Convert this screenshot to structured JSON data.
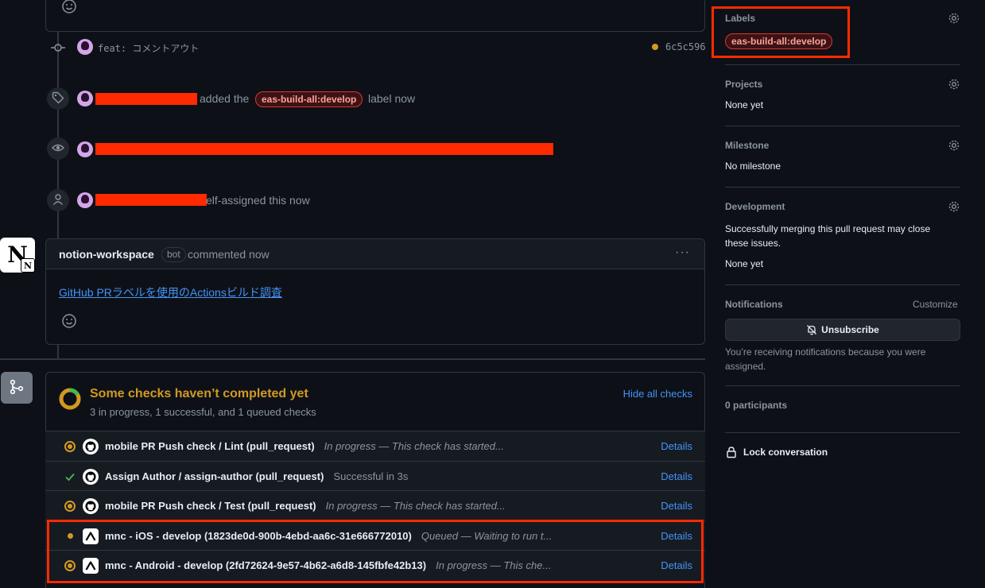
{
  "timeline": {
    "commit": {
      "message": "feat: コメントアウト",
      "sha": "6c5c596"
    },
    "label_event": {
      "verb": "added the",
      "label": "eas-build-all:develop",
      "suffix": "label now"
    },
    "assign_event": {
      "suffix": "elf-assigned this now"
    },
    "comment": {
      "author": "notion-workspace",
      "badge": "bot",
      "action": "commented now",
      "more": "···",
      "link_text": "GitHub PRラベルを使用のActionsビルド調査"
    }
  },
  "checks": {
    "title": "Some checks haven’t completed yet",
    "summary": "3 in progress, 1 successful, and 1 queued checks",
    "hide_label": "Hide all checks",
    "details_label": "Details",
    "items": [
      {
        "status": "in_progress",
        "name": "mobile PR Push check / Lint (pull_request)",
        "desc": "In progress — This check has started...",
        "italic": true,
        "app": "github"
      },
      {
        "status": "success",
        "name": "Assign Author / assign-author (pull_request)",
        "desc": "Successful in 3s",
        "italic": false,
        "app": "github"
      },
      {
        "status": "in_progress",
        "name": "mobile PR Push check / Test (pull_request)",
        "desc": "In progress — This check has started...",
        "italic": true,
        "app": "github"
      },
      {
        "status": "queued",
        "name": "mnc - iOS - develop (1823de0d-900b-4ebd-aa6c-31e666772010)",
        "desc": "Queued — Waiting to run t...",
        "italic": true,
        "app": "expo"
      },
      {
        "status": "in_progress",
        "name": "mnc - Android - develop (2fd72624-9e57-4b62-a6d8-145fbfe42b13)",
        "desc": "In progress — This che...",
        "italic": true,
        "app": "expo"
      }
    ]
  },
  "sidebar": {
    "labels": {
      "title": "Labels",
      "value": "eas-build-all:develop"
    },
    "projects": {
      "title": "Projects",
      "value": "None yet"
    },
    "milestone": {
      "title": "Milestone",
      "value": "No milestone"
    },
    "development": {
      "title": "Development",
      "description": "Successfully merging this pull request may close these issues.",
      "value": "None yet"
    },
    "notifications": {
      "title": "Notifications",
      "customize": "Customize",
      "button": "Unsubscribe",
      "reason": "You’re receiving notifications because you were assigned."
    },
    "participants": "0 participants",
    "lock": "Lock conversation"
  },
  "colors": {
    "background": "#0d1117",
    "accent_link": "#4493f8",
    "pending": "#d29922",
    "success": "#3fb950",
    "annotation": "#ff2a00"
  }
}
